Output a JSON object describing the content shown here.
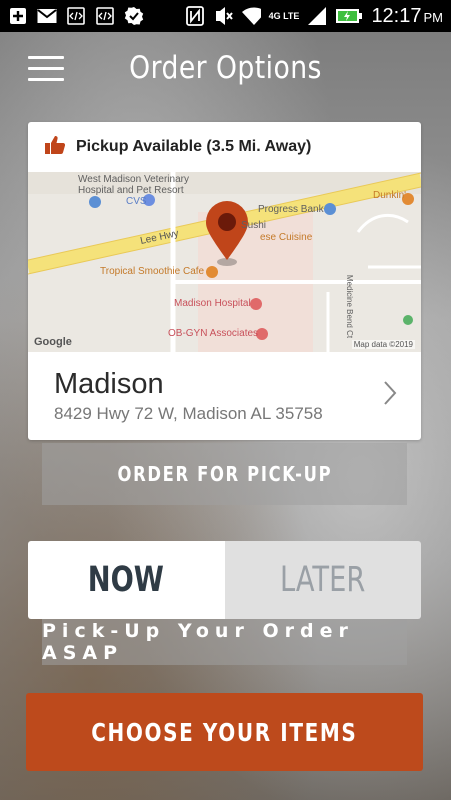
{
  "status_bar": {
    "time": "12:17",
    "ampm": "PM",
    "network": "4G LTE",
    "icons": [
      "add-icon",
      "gmail-icon",
      "code-icon",
      "code-icon",
      "check-icon"
    ],
    "right_icons": [
      "nfc-icon",
      "mute-icon",
      "wifi-icon",
      "signal-icon",
      "battery-charging-icon"
    ]
  },
  "header": {
    "menu_icon": "hamburger-icon",
    "title": "Order Options"
  },
  "location_card": {
    "status_text": "Pickup Available (3.5 Mi. Away)",
    "status_icon": "thumbs-up-icon",
    "map": {
      "labels": {
        "vet": "West Madison Veterinary\nHospital and Pet Resort",
        "cvs": "CVS",
        "progress_bank": "Progress Bank",
        "dunkin": "Dunkin'",
        "lee_hwy": "Lee Hwy",
        "sushi": "Sushi",
        "chinese": "ese Cuisine",
        "tropical": "Tropical Smoothie Cafe",
        "madison_hospital": "Madison Hospital",
        "obgyn": "OB-GYN Associates",
        "medicine_bend": "Medicine Bend Ct"
      },
      "google_logo": "Google",
      "map_data": "Map data ©2019"
    },
    "name": "Madison",
    "address": "8429 Hwy 72 W, Madison AL 35758",
    "chevron_icon": "chevron-right-icon"
  },
  "order_type_button": "ORDER FOR PICK-UP",
  "timing": {
    "now": "NOW",
    "later": "LATER",
    "selected": "NOW"
  },
  "timing_note": "Pick-Up Your Order ASAP",
  "cta": "CHOOSE YOUR ITEMS",
  "colors": {
    "accent": "#bd4a1c",
    "pin": "#c0451a",
    "now_text": "#2f3b45"
  }
}
